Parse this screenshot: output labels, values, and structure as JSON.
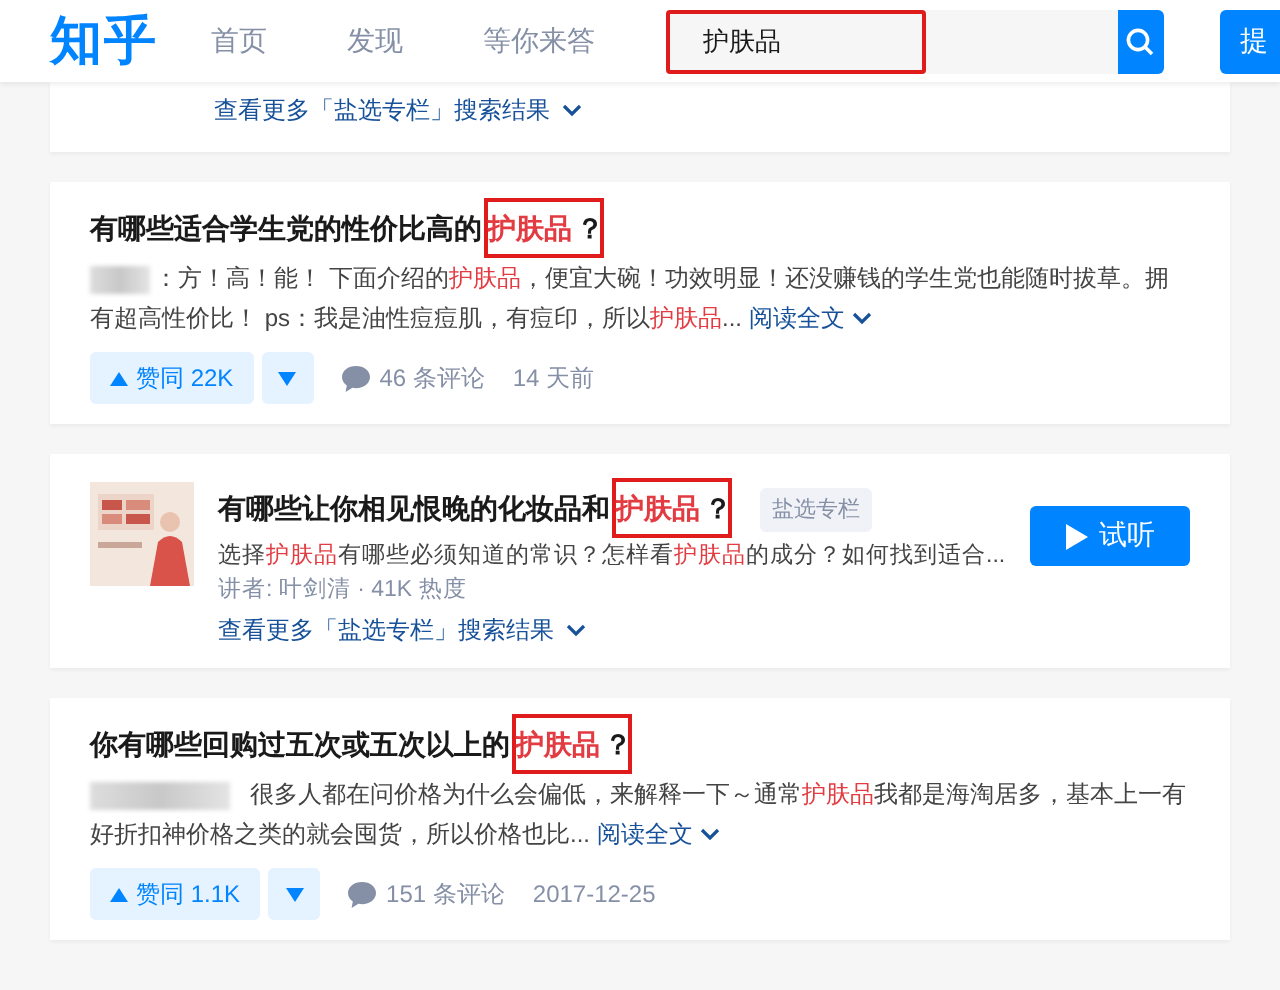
{
  "header": {
    "logo": "知乎",
    "nav": [
      {
        "label": "首页",
        "selected": false
      },
      {
        "label": "发现",
        "selected": false
      },
      {
        "label": "等你来答",
        "selected": false
      }
    ],
    "search": {
      "value": "护肤品",
      "outlined": true
    },
    "ask_button": "提"
  },
  "results": [
    {
      "kind": "more",
      "more_link": "查看更多「盐选专栏」搜索结果"
    },
    {
      "kind": "answer",
      "title": [
        {
          "text": "有哪些适合学生党的性价比高的",
          "highlight": false,
          "outlined": false
        },
        {
          "text": "护肤品",
          "highlight": true,
          "outlined": true
        },
        {
          "text": "？",
          "highlight": false,
          "outlined": false
        }
      ],
      "author_hidden": true,
      "excerpt": [
        {
          "text": "：方！高！能！ 下面介绍的",
          "highlight": false
        },
        {
          "text": "护肤品",
          "highlight": true
        },
        {
          "text": "，便宜大碗！功效明显！还没赚钱的学生党也能随时拔草。拥有超高性价比！ ps：我是油性痘痘肌，有痘印，所以",
          "highlight": false
        },
        {
          "text": "护肤品",
          "highlight": true
        },
        {
          "text": "...",
          "highlight": false
        }
      ],
      "read_more": "阅读全文",
      "upvote": "赞同 22K",
      "comments": "46 条评论",
      "time": "14 天前"
    },
    {
      "kind": "column",
      "title": [
        {
          "text": "有哪些让你相见恨晚的化妆品和",
          "highlight": false,
          "outlined": false
        },
        {
          "text": "护肤品",
          "highlight": true,
          "outlined": true
        },
        {
          "text": "？",
          "highlight": false,
          "outlined": false
        }
      ],
      "tag": "盐选专栏",
      "excerpt": [
        {
          "text": "选择",
          "highlight": false
        },
        {
          "text": "护肤品",
          "highlight": true
        },
        {
          "text": "有哪些必须知道的常识？怎样看",
          "highlight": false
        },
        {
          "text": "护肤品",
          "highlight": true
        },
        {
          "text": "的成分？如何找到适合...",
          "highlight": false
        }
      ],
      "meta": "讲者: 叶剑清 · 41K 热度",
      "listen_button": "试听",
      "more_link": "查看更多「盐选专栏」搜索结果"
    },
    {
      "kind": "answer",
      "title": [
        {
          "text": "你有哪些回购过五次或五次以上的",
          "highlight": false,
          "outlined": false
        },
        {
          "text": "护肤品",
          "highlight": true,
          "outlined": true
        },
        {
          "text": "？",
          "highlight": false,
          "outlined": false
        }
      ],
      "author_hidden": true,
      "excerpt": [
        {
          "text": "很多人都在问价格为什么会偏低，来解释一下～通常",
          "highlight": false
        },
        {
          "text": "护肤品",
          "highlight": true
        },
        {
          "text": "我都是海淘居多，基本上一有好折扣神价格之类的就会囤货，所以价格也比...",
          "highlight": false
        }
      ],
      "read_more": "阅读全文",
      "upvote": "赞同 1.1K",
      "comments": "151 条评论",
      "time": "2017-12-25"
    }
  ]
}
